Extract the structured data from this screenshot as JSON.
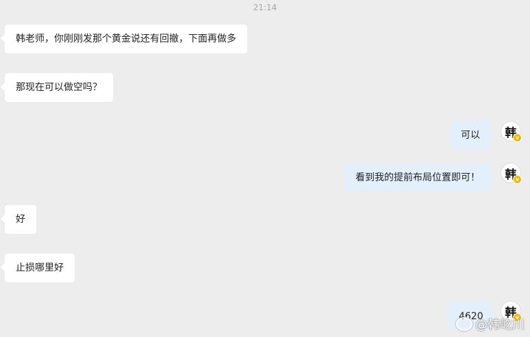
{
  "chat": {
    "timestamp": "21:14",
    "messages": [
      {
        "side": "left",
        "text": "韩老师，你刚刚发那个黄金说还有回撤，下面再做多"
      },
      {
        "side": "left",
        "text": "那现在可以做空吗？"
      },
      {
        "side": "right",
        "text": "可以"
      },
      {
        "side": "right",
        "text": "看到我的提前布局位置即可！"
      },
      {
        "side": "left",
        "text": "好"
      },
      {
        "side": "left",
        "text": "止损哪里好"
      },
      {
        "side": "right",
        "text": "4620"
      }
    ],
    "avatar": {
      "char": "韩",
      "badge": "v",
      "badge_color": "#f5b800"
    }
  },
  "watermark": {
    "text": "@韩屹川",
    "icon": "weibo-icon"
  },
  "colors": {
    "background": "#ededed",
    "incoming": "#ffffff",
    "outgoing": "#e3effb"
  }
}
